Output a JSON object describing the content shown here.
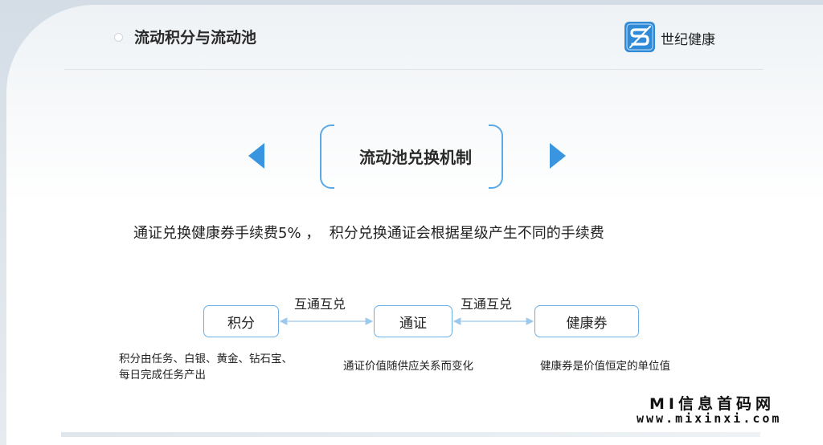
{
  "header": {
    "section_title": "流动积分与流动池",
    "logo_text": "世纪健康",
    "logo_icon": "s-letter-logo-icon"
  },
  "mechanism": {
    "title": "流动池兑换机制",
    "fee_text": "通证兑换健康券手续费5% ，  积分兑换通证会根据星级产生不同的手续费"
  },
  "flow": {
    "nodes": [
      {
        "label": "积分",
        "description": "积分由任务、白银、黄金、钻石宝、每日完成任务产出"
      },
      {
        "label": "通证",
        "description": "通证价值随供应关系而变化"
      },
      {
        "label": "健康券",
        "description": "健康券是价值恒定的单位值"
      }
    ],
    "links": [
      {
        "label": "互通互兑"
      },
      {
        "label": "互通互兑"
      }
    ]
  },
  "watermark": {
    "line1": "MI信息首码网",
    "line2": "www.mixinxi.com"
  },
  "colors": {
    "accent": "#3a95e0",
    "node_border": "#6ab0e8",
    "arrow": "#9cc8ec"
  }
}
